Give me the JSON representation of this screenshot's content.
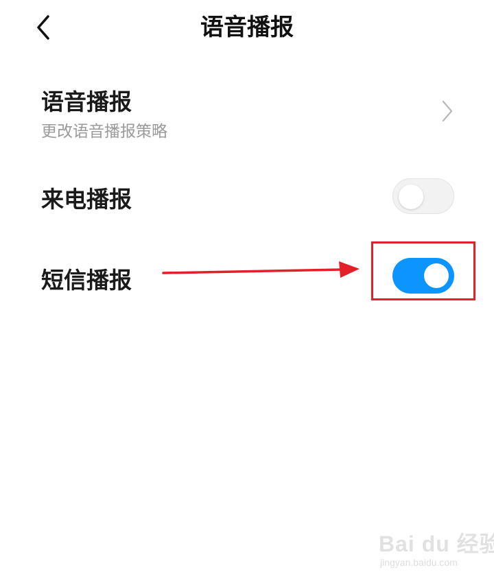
{
  "header": {
    "title": "语音播报",
    "back_icon": "chevron-left-icon"
  },
  "settings": {
    "voice_broadcast": {
      "title": "语音播报",
      "subtitle": "更改语音播报策略",
      "icon": "chevron-right-icon"
    },
    "call_broadcast": {
      "title": "来电播报",
      "enabled": false
    },
    "sms_broadcast": {
      "title": "短信播报",
      "enabled": true
    }
  },
  "annotation": {
    "highlight_color": "#e3202a",
    "arrow_color": "#e3202a"
  },
  "colors": {
    "switch_on": "#0c95ff",
    "switch_off": "#f2f2f2"
  },
  "watermark": {
    "logo": "Bai du 经验",
    "url": "jingyan.baidu.com"
  }
}
